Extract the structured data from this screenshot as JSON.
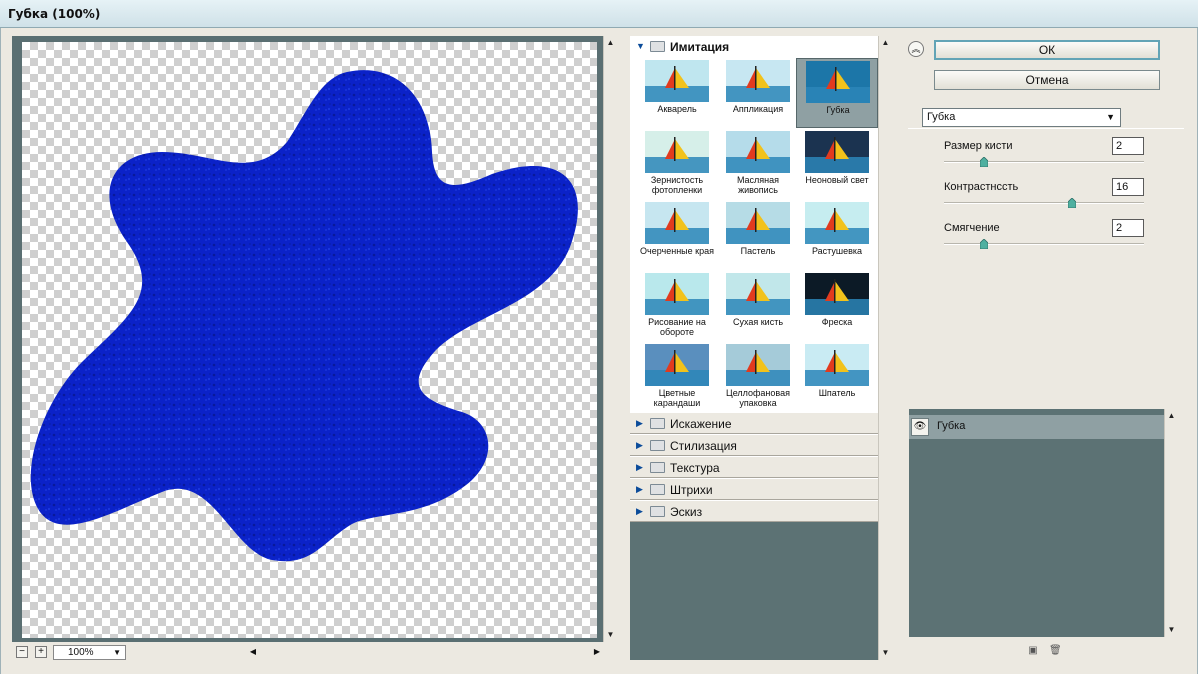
{
  "window": {
    "title": "Губка (100%)"
  },
  "preview": {
    "zoom_value": "100%",
    "zoom_out_label": "−",
    "zoom_in_label": "+"
  },
  "gallery": {
    "open_category": {
      "label": "Имитация",
      "filters": [
        {
          "label": "Акварель"
        },
        {
          "label": "Аппликация"
        },
        {
          "label": "Губка",
          "selected": true
        },
        {
          "label": "Зернистость фотопленки"
        },
        {
          "label": "Масляная живопись"
        },
        {
          "label": "Неоновый свет"
        },
        {
          "label": "Очерченные края"
        },
        {
          "label": "Пастель"
        },
        {
          "label": "Растушевка"
        },
        {
          "label": "Рисование на обороте"
        },
        {
          "label": "Сухая кисть"
        },
        {
          "label": "Фреска"
        },
        {
          "label": "Цветные карандаши"
        },
        {
          "label": "Целлофановая упаковка"
        },
        {
          "label": "Шпатель"
        }
      ]
    },
    "closed_categories": [
      {
        "label": "Искажение"
      },
      {
        "label": "Стилизация"
      },
      {
        "label": "Текстура"
      },
      {
        "label": "Штрихи"
      },
      {
        "label": "Эскиз"
      }
    ]
  },
  "actions": {
    "ok_label": "ОК",
    "cancel_label": "Отмена"
  },
  "filter_select": {
    "value": "Губка"
  },
  "params": [
    {
      "label": "Размер кисти",
      "value": "2",
      "level": 0.2
    },
    {
      "label": "Контрастнссть",
      "value": "16",
      "level": 0.64
    },
    {
      "label": "Смягчение",
      "value": "2",
      "level": 0.2
    }
  ],
  "layers": [
    {
      "label": "Губка"
    }
  ],
  "colors": {
    "accent": "#62a4b6",
    "panel": "#5c7274",
    "selected": "#8fa0a3",
    "blob": "#0b22c8"
  }
}
